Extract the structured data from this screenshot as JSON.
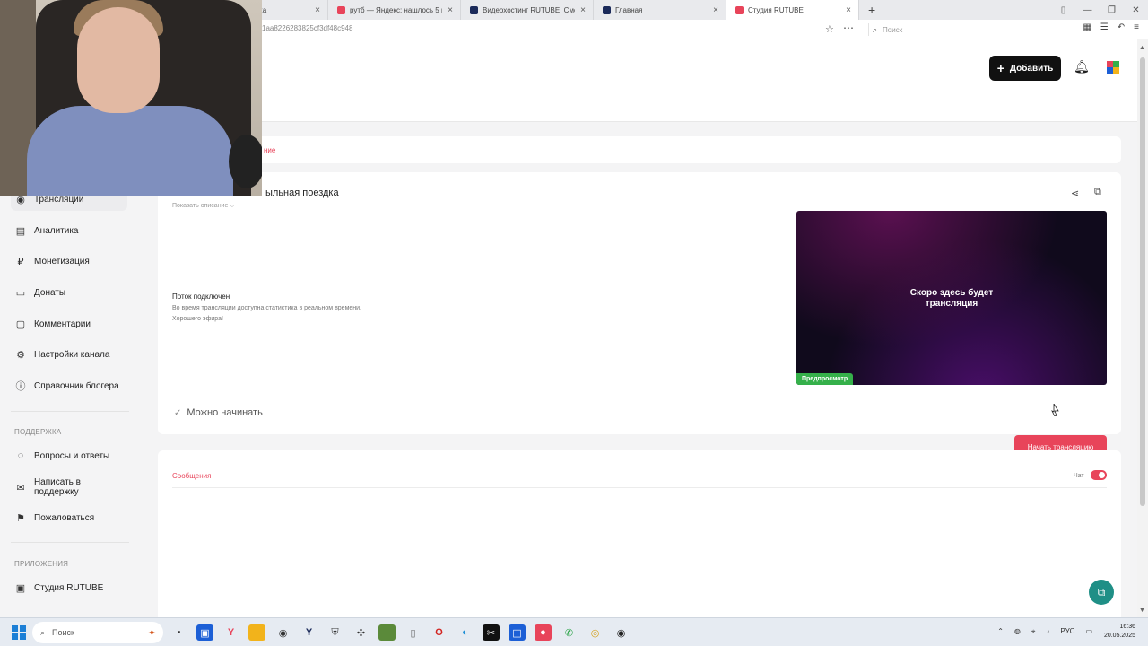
{
  "browser": {
    "tabs": [
      {
        "title": "",
        "active": false,
        "favicon_color": "#9aa"
      },
      {
        "title": "Новая вкладка",
        "active": false,
        "favicon_color": "#666"
      },
      {
        "title": "рутб — Яндекс: нашлось 5 м",
        "active": false,
        "favicon_color": "#e8445a"
      },
      {
        "title": "Видеохостинг RUTUBE. Смо",
        "active": false,
        "favicon_color": "#1b2a5a"
      },
      {
        "title": "Главная",
        "active": false,
        "favicon_color": "#1b2a5a"
      },
      {
        "title": "Студия RUTUBE",
        "active": true,
        "favicon_color": "#e8445a"
      }
    ],
    "new_tab": "+",
    "url": "1aa8226283825cf3df48c948",
    "search_placeholder": "Поиск"
  },
  "header": {
    "add_button": "Добавить"
  },
  "sidebar": {
    "items": [
      {
        "label": "Трансляции",
        "icon": "broadcast-icon",
        "glyph": "◉"
      },
      {
        "label": "Аналитика",
        "icon": "analytics-icon",
        "glyph": "▤"
      },
      {
        "label": "Монетизация",
        "icon": "ruble-icon",
        "glyph": "₽"
      },
      {
        "label": "Донаты",
        "icon": "donate-icon",
        "glyph": "▭"
      },
      {
        "label": "Комментарии",
        "icon": "comments-icon",
        "glyph": "▢"
      },
      {
        "label": "Настройки канала",
        "icon": "settings-icon",
        "glyph": "⚙"
      },
      {
        "label": "Справочник блогера",
        "icon": "info-icon",
        "glyph": "ⓘ"
      }
    ],
    "support_label": "ПОДДЕРЖКА",
    "support_items": [
      {
        "label": "Вопросы и ответы",
        "icon": "faq-icon",
        "glyph": "◌"
      },
      {
        "label": "Написать в поддержку",
        "icon": "mail-icon",
        "glyph": "✉"
      },
      {
        "label": "Пожаловаться",
        "icon": "flag-icon",
        "glyph": "⚑"
      }
    ],
    "apps_label": "ПРИЛОЖЕНИЯ",
    "apps_items": [
      {
        "label": "Студия RUTUBE",
        "icon": "studio-icon",
        "glyph": "▣"
      }
    ]
  },
  "tabs_card": {
    "active_tab": "ние"
  },
  "stream": {
    "title": "ыльная поездка",
    "show_description": "Показать описание ⌵",
    "status_heading": "Поток подключен",
    "status_line1": "Во время трансляции доступна статистика в реальном времени.",
    "status_line2": "Хорошего эфира!",
    "preview_text_1": "Скоро здесь будет",
    "preview_text_2": "трансляция",
    "preview_badge": "Предпросмотр",
    "ready": "Можно начинать",
    "start_button": "Начать трансляцию"
  },
  "chat": {
    "tab": "Сообщения",
    "toggle_label": "Чат",
    "toggle_on": true
  },
  "taskbar": {
    "search": "Поиск",
    "lang": "РУС",
    "time": "16:36",
    "date": "20.05.2025"
  },
  "colors": {
    "accent": "#e8445a",
    "preview_badge": "#35b04a",
    "fab": "#1f8f86"
  }
}
